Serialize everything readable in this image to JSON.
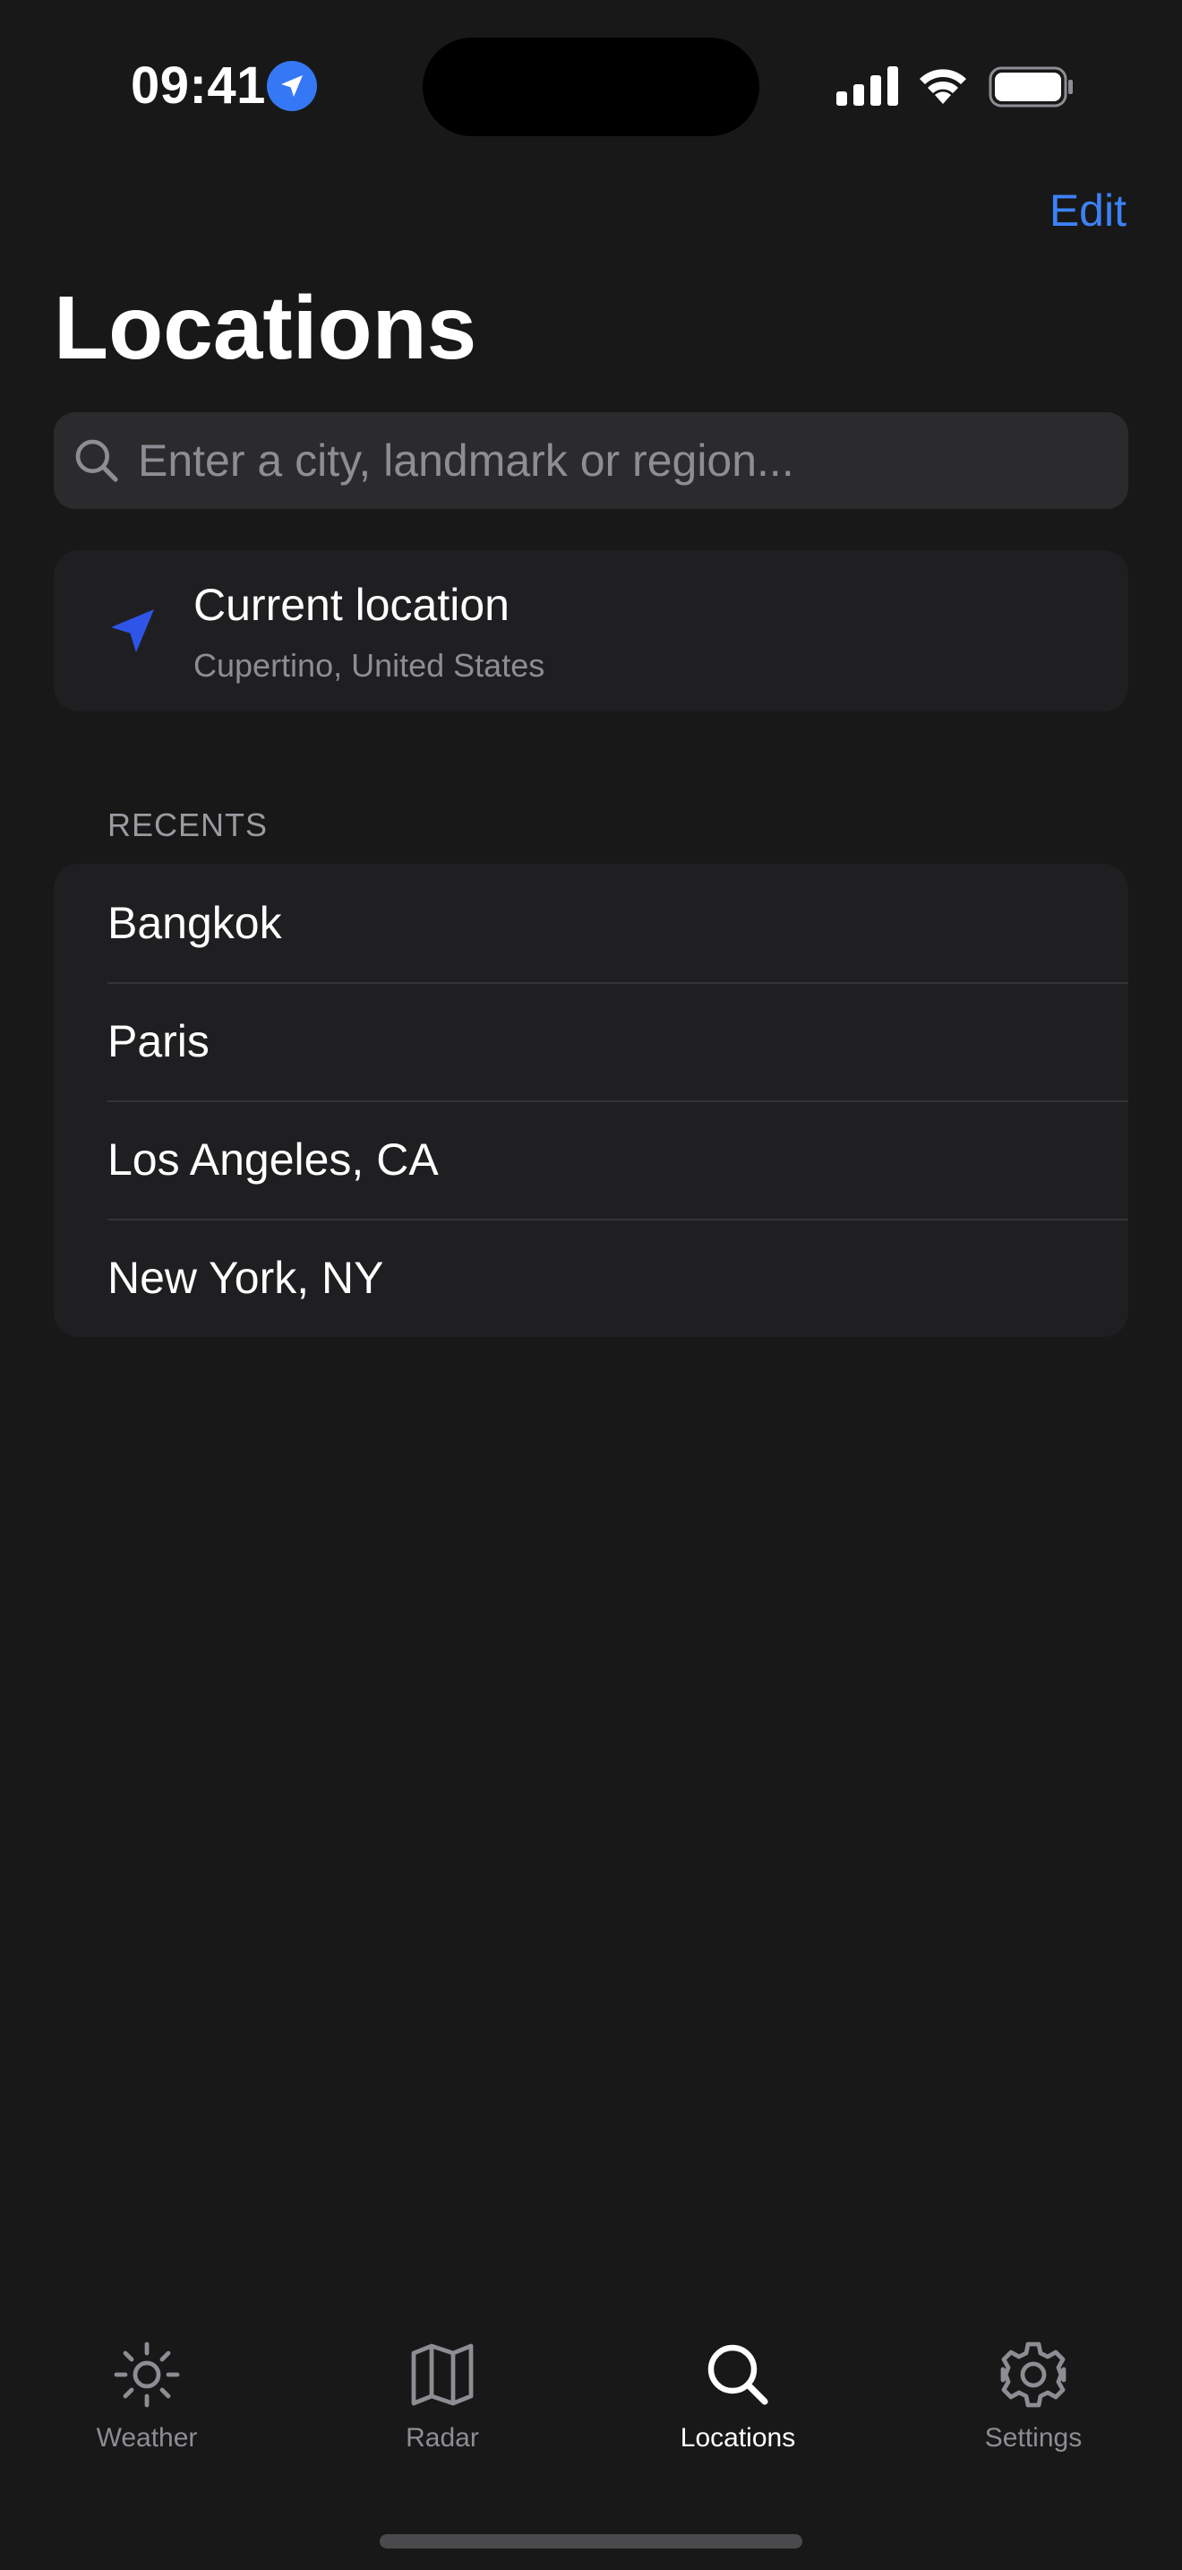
{
  "status_bar": {
    "time": "09:41"
  },
  "header": {
    "edit_label": "Edit",
    "title": "Locations"
  },
  "search": {
    "placeholder": "Enter a city, landmark or region...",
    "value": ""
  },
  "current_location": {
    "title": "Current location",
    "subtitle": "Cupertino, United States"
  },
  "recents": {
    "header": "RECENTS",
    "items": [
      {
        "label": "Bangkok"
      },
      {
        "label": "Paris"
      },
      {
        "label": "Los Angeles, CA"
      },
      {
        "label": "New York, NY"
      }
    ]
  },
  "tab_bar": {
    "tabs": [
      {
        "label": "Weather",
        "icon": "sun-icon",
        "active": false
      },
      {
        "label": "Radar",
        "icon": "map-icon",
        "active": false
      },
      {
        "label": "Locations",
        "icon": "search-icon",
        "active": true
      },
      {
        "label": "Settings",
        "icon": "gear-icon",
        "active": false
      }
    ]
  },
  "colors": {
    "background": "#181818",
    "accent": "#3c82f6",
    "card": "#1f1f21",
    "search_field": "#2b2b2d",
    "secondary_text": "#8d8d93",
    "location_icon": "#2f55e8"
  }
}
